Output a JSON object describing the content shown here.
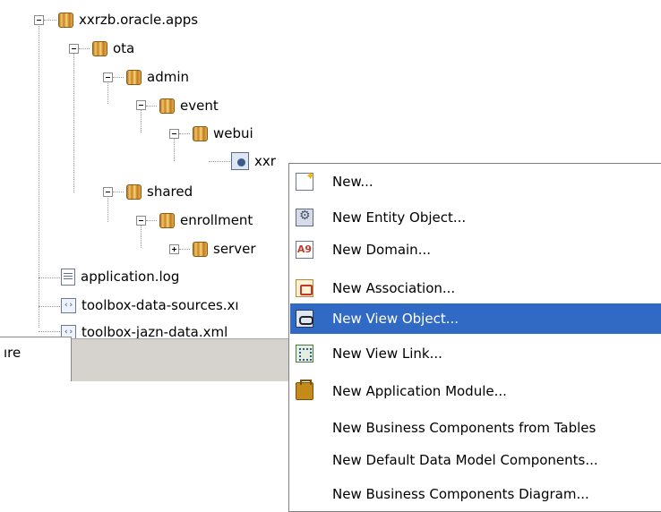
{
  "tree": {
    "nodes": [
      {
        "label": "xxrzb.oracle.apps",
        "type": "package"
      },
      {
        "label": "ota",
        "type": "package"
      },
      {
        "label": "admin",
        "type": "package"
      },
      {
        "label": "event",
        "type": "package"
      },
      {
        "label": "webui",
        "type": "package"
      },
      {
        "label": "xxr",
        "type": "view-object"
      },
      {
        "label": "shared",
        "type": "package"
      },
      {
        "label": "enrollment",
        "type": "package"
      },
      {
        "label": "server",
        "type": "package"
      },
      {
        "label": "application.log",
        "type": "log-file"
      },
      {
        "label": "toolbox-data-sources.xı",
        "type": "xml-file"
      },
      {
        "label": "toolbox-jazn-data.xml",
        "type": "xml-file"
      }
    ]
  },
  "bottom_panel": {
    "tab_label": "ıre"
  },
  "context_menu": {
    "items": [
      {
        "label": "New...",
        "icon": "new-icon",
        "selected": false
      },
      {
        "label": "New Entity Object...",
        "icon": "entity-object-icon",
        "selected": false
      },
      {
        "label": "New Domain...",
        "icon": "domain-icon",
        "selected": false
      },
      {
        "label": "New Association...",
        "icon": "association-icon",
        "selected": false
      },
      {
        "label": "New View Object...",
        "icon": "view-object-icon",
        "selected": true
      },
      {
        "label": "New View Link...",
        "icon": "view-link-icon",
        "selected": false
      },
      {
        "label": "New Application Module...",
        "icon": "application-module-icon",
        "selected": false
      },
      {
        "label": "New Business Components from Tables",
        "icon": "",
        "selected": false
      },
      {
        "label": "New Default Data Model Components...",
        "icon": "",
        "selected": false
      },
      {
        "label": "New Business Components Diagram...",
        "icon": "",
        "selected": false
      }
    ]
  },
  "colors": {
    "selection": "#316ac5",
    "panel": "#d6d3ce"
  }
}
